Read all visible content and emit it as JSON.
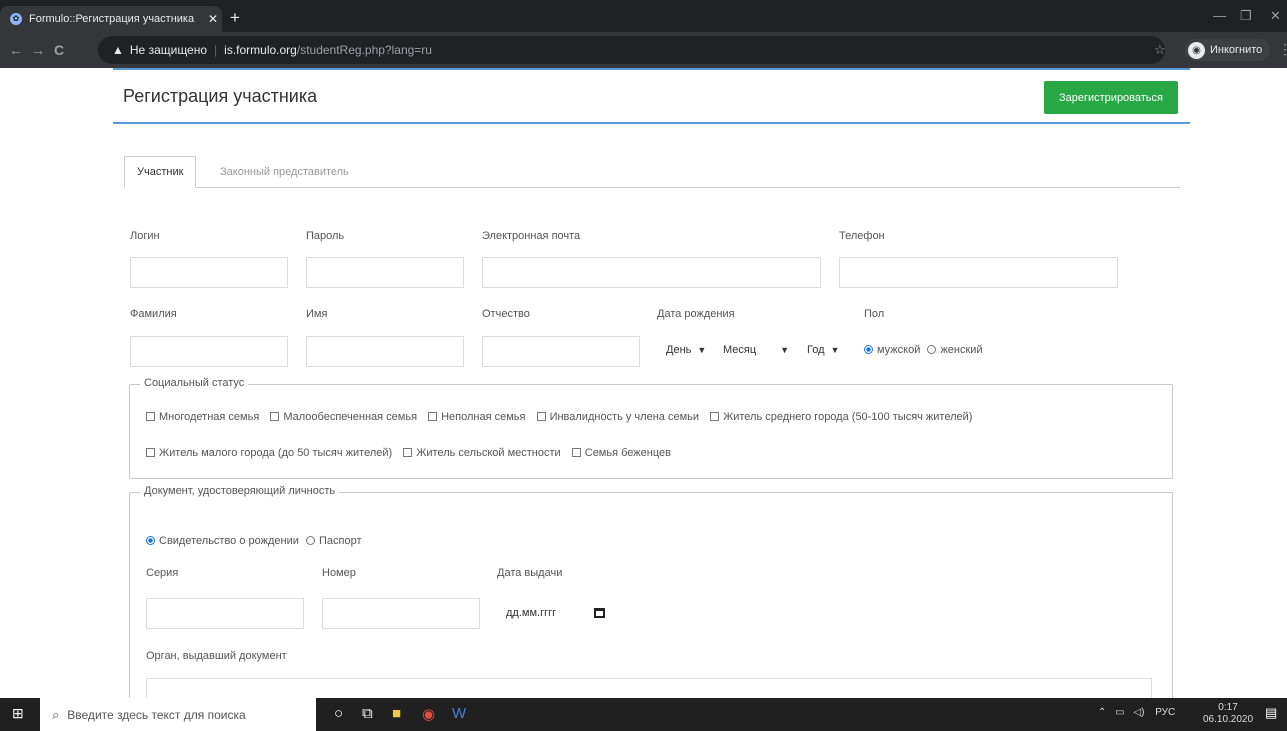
{
  "browser": {
    "tab_title": "Formulo::Регистрация участника",
    "new_tab": "+",
    "security": "Не защищено",
    "url_domain": "is.formulo.org",
    "url_path": "/studentReg.php?lang=ru",
    "incognito": "Инкогнито"
  },
  "page": {
    "title": "Регистрация участника",
    "register_button": "Зарегистрироваться",
    "tabs": [
      "Участник",
      "Законный представитель"
    ]
  },
  "fields": {
    "login": "Логин",
    "password": "Пароль",
    "email": "Электронная почта",
    "phone": "Телефон",
    "surname": "Фамилия",
    "name": "Имя",
    "patronymic": "Отчество",
    "birthdate": "Дата рождения",
    "gender": "Пол",
    "day": "День",
    "month": "Месяц",
    "year": "Год",
    "male": "мужской",
    "female": "женский"
  },
  "social": {
    "legend": "Социальный статус",
    "row1": [
      "Многодетная семья",
      "Малообеспеченная семья",
      "Неполная семья",
      "Инвалидность у члена семьи",
      "Житель среднего города (50-100 тысяч жителей)"
    ],
    "row2": [
      "Житель малого города (до 50 тысяч жителей)",
      "Житель сельской местности",
      "Семья беженцев"
    ]
  },
  "document": {
    "legend": "Документ, удостоверяющий личность",
    "birth_cert": "Свидетельство о рождении",
    "passport": "Паспорт",
    "series": "Серия",
    "number": "Номер",
    "issue_date": "Дата выдачи",
    "date_placeholder": "дд.мм.гггг",
    "issuer": "Орган, выдавший документ"
  },
  "taskbar": {
    "search_placeholder": "Введите здесь текст для поиска",
    "lang": "РУС",
    "time": "0:17",
    "date": "06.10.2020"
  }
}
